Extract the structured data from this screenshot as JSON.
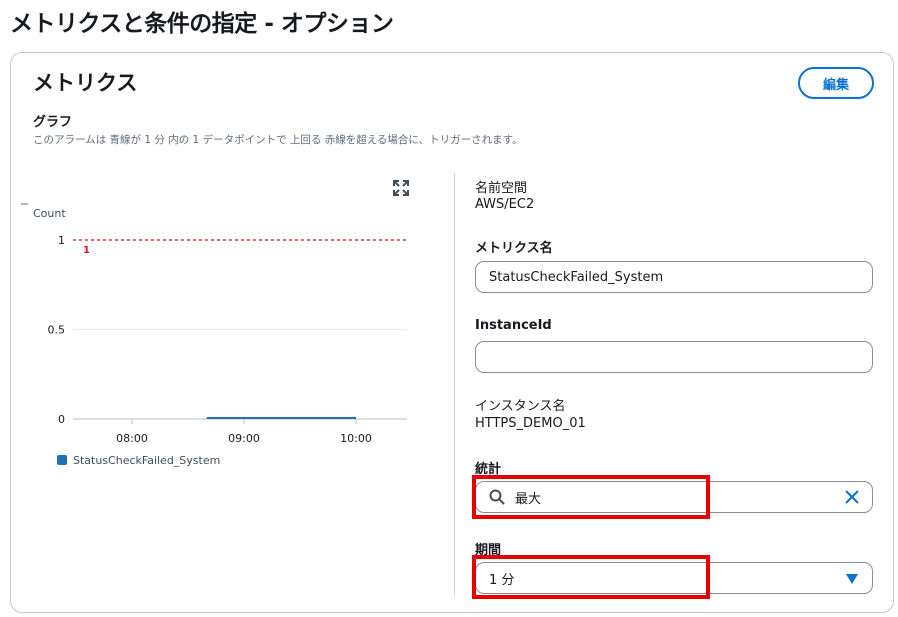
{
  "page": {
    "title": "メトリクスと条件の指定 - オプション"
  },
  "panel": {
    "title": "メトリクス",
    "edit_label": "編集",
    "graph_heading": "グラフ",
    "graph_description": "このアラームは 青線が 1 分 内の 1 データポイントで 上回る 赤線を超える場合に、トリガーされます。"
  },
  "chart_data": {
    "type": "line",
    "ylabel": "Count",
    "ylim": [
      0,
      1
    ],
    "yticks": [
      "1",
      "0.5",
      "0"
    ],
    "xticks": [
      "08:00",
      "09:00",
      "10:00"
    ],
    "threshold": {
      "value": 1,
      "label": "1",
      "color": "#d91515"
    },
    "series": [
      {
        "name": "StatusCheckFailed_System",
        "color": "#2070b5",
        "x": [
          "08:40",
          "10:00"
        ],
        "values": [
          0,
          0
        ]
      }
    ]
  },
  "details": {
    "namespace_label": "名前空間",
    "namespace_value": "AWS/EC2",
    "metric_name_label": "メトリクス名",
    "metric_name_value": "StatusCheckFailed_System",
    "instance_id_label": "InstanceId",
    "instance_id_value": "",
    "instance_name_label": "インスタンス名",
    "instance_name_value": "HTTPS_DEMO_01",
    "statistic_label": "統計",
    "statistic_value": "最大",
    "period_label": "期間",
    "period_value": "1 分"
  },
  "colors": {
    "accent": "#0972d3",
    "highlight": "#e60000",
    "threshold": "#d91515",
    "series": "#2070b5"
  }
}
